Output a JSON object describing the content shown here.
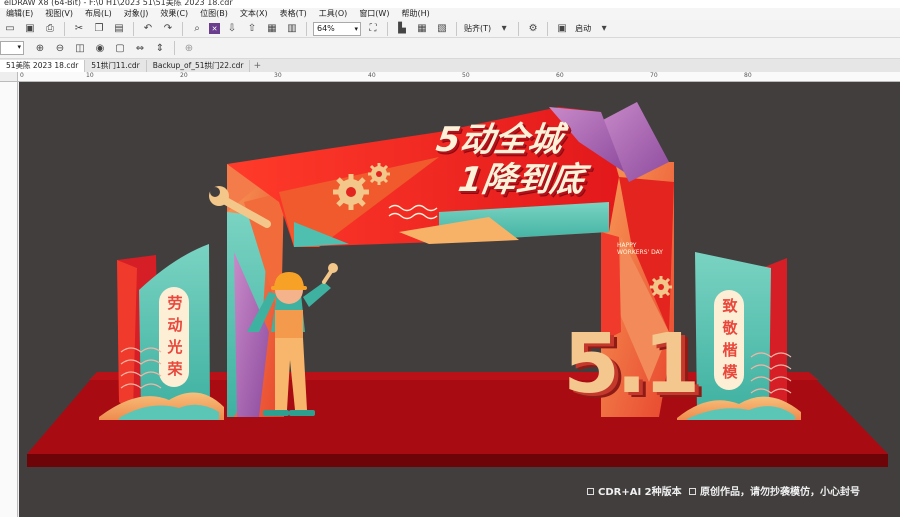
{
  "window": {
    "title": "elDRAW X8 (64-Bit) - F:\\0 H1\\2023 51\\51美陈 2023 18.cdr"
  },
  "menu": [
    "编辑(E)",
    "视图(V)",
    "布局(L)",
    "对象(J)",
    "效果(C)",
    "位图(B)",
    "文本(X)",
    "表格(T)",
    "工具(O)",
    "窗口(W)",
    "帮助(H)"
  ],
  "toolbar": {
    "zoom_value": "64%",
    "snap_label": "贴齐(T)",
    "launch_label": "启动"
  },
  "tabs": [
    {
      "label": "51美陈 2023 18.cdr",
      "active": true
    },
    {
      "label": "51拱门11.cdr",
      "active": false
    },
    {
      "label": "Backup_of_51拱门22.cdr",
      "active": false
    }
  ],
  "ruler": {
    "marks": [
      "0",
      "10",
      "20",
      "30",
      "40",
      "50",
      "60",
      "70",
      "80"
    ]
  },
  "artwork": {
    "headline_line1": "5动全城",
    "headline_line2": "1降到底",
    "left_banner": [
      "劳",
      "动",
      "光",
      "荣"
    ],
    "right_banner": [
      "致",
      "敬",
      "楷",
      "模"
    ],
    "happy_line1": "HAPPY",
    "happy_line2": "WORKERS' DAY",
    "big_number": "5.1"
  },
  "notices": [
    "CDR+AI 2种版本",
    "原创作品，请勿抄袭模仿，小心封号"
  ],
  "colors": {
    "background": "#423e3e",
    "brand_red": "#e8261f",
    "teal": "#5cc6b6",
    "stage": "#a40a0f"
  }
}
